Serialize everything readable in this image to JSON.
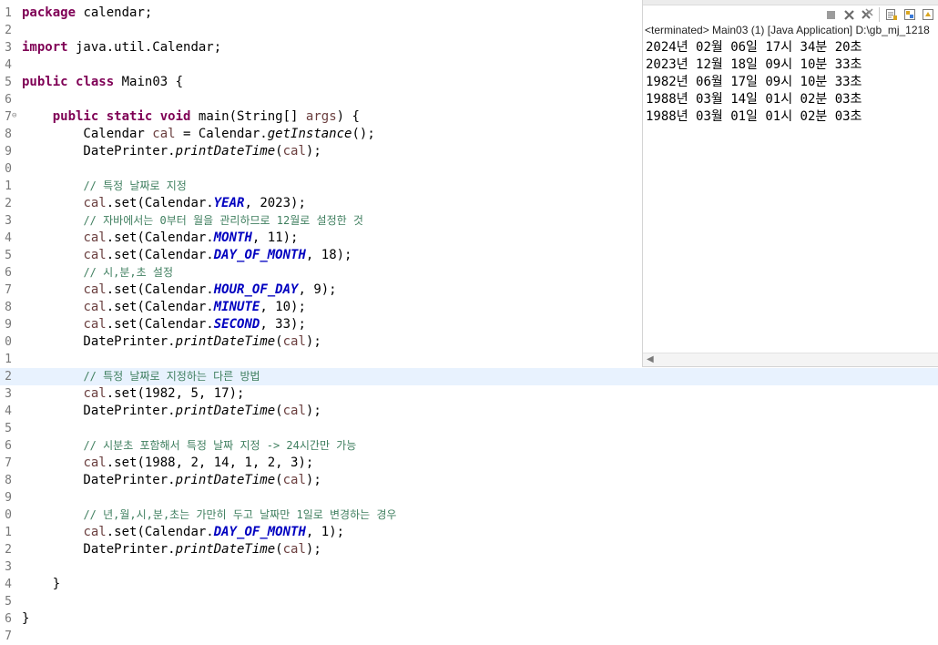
{
  "editor": {
    "lines": [
      {
        "num": "1",
        "tokens": [
          [
            "kw",
            "package"
          ],
          [
            "pl",
            " calendar;"
          ]
        ]
      },
      {
        "num": "2",
        "tokens": []
      },
      {
        "num": "3",
        "tokens": [
          [
            "kw",
            "import"
          ],
          [
            "pl",
            " java.util.Calendar;"
          ]
        ]
      },
      {
        "num": "4",
        "tokens": []
      },
      {
        "num": "5",
        "tokens": [
          [
            "kw",
            "public"
          ],
          [
            "pl",
            " "
          ],
          [
            "kw",
            "class"
          ],
          [
            "pl",
            " Main03 {"
          ]
        ]
      },
      {
        "num": "6",
        "tokens": []
      },
      {
        "num": "7",
        "fold": "⊖",
        "tokens": [
          [
            "pl",
            "    "
          ],
          [
            "kw",
            "public"
          ],
          [
            "pl",
            " "
          ],
          [
            "kw",
            "static"
          ],
          [
            "pl",
            " "
          ],
          [
            "kw",
            "void"
          ],
          [
            "pl",
            " main(String[] "
          ],
          [
            "var",
            "args"
          ],
          [
            "pl",
            ") {"
          ]
        ]
      },
      {
        "num": "8",
        "tokens": [
          [
            "pl",
            "        Calendar "
          ],
          [
            "var",
            "cal"
          ],
          [
            "pl",
            " = Calendar."
          ],
          [
            "mth",
            "getInstance"
          ],
          [
            "pl",
            "();"
          ]
        ]
      },
      {
        "num": "9",
        "tokens": [
          [
            "pl",
            "        DatePrinter."
          ],
          [
            "mth",
            "printDateTime"
          ],
          [
            "pl",
            "("
          ],
          [
            "var",
            "cal"
          ],
          [
            "pl",
            ");"
          ]
        ]
      },
      {
        "num": "0",
        "tokens": []
      },
      {
        "num": "1",
        "tokens": [
          [
            "pl",
            "        "
          ],
          [
            "cmt",
            "// 특정 날짜로 지정"
          ]
        ]
      },
      {
        "num": "2",
        "tokens": [
          [
            "pl",
            "        "
          ],
          [
            "var",
            "cal"
          ],
          [
            "pl",
            ".set(Calendar."
          ],
          [
            "cst",
            "YEAR"
          ],
          [
            "pl",
            ", 2023);"
          ]
        ]
      },
      {
        "num": "3",
        "tokens": [
          [
            "pl",
            "        "
          ],
          [
            "cmt",
            "// 자바에서는 0부터 월을 관리하므로 12월로 설정한 것"
          ]
        ]
      },
      {
        "num": "4",
        "tokens": [
          [
            "pl",
            "        "
          ],
          [
            "var",
            "cal"
          ],
          [
            "pl",
            ".set(Calendar."
          ],
          [
            "cst",
            "MONTH"
          ],
          [
            "pl",
            ", 11);"
          ]
        ]
      },
      {
        "num": "5",
        "tokens": [
          [
            "pl",
            "        "
          ],
          [
            "var",
            "cal"
          ],
          [
            "pl",
            ".set(Calendar."
          ],
          [
            "cst",
            "DAY_OF_MONTH"
          ],
          [
            "pl",
            ", 18);"
          ]
        ]
      },
      {
        "num": "6",
        "tokens": [
          [
            "pl",
            "        "
          ],
          [
            "cmt",
            "// 시,분,초 설정"
          ]
        ]
      },
      {
        "num": "7",
        "tokens": [
          [
            "pl",
            "        "
          ],
          [
            "var",
            "cal"
          ],
          [
            "pl",
            ".set(Calendar."
          ],
          [
            "cst",
            "HOUR_OF_DAY"
          ],
          [
            "pl",
            ", 9);"
          ]
        ]
      },
      {
        "num": "8",
        "tokens": [
          [
            "pl",
            "        "
          ],
          [
            "var",
            "cal"
          ],
          [
            "pl",
            ".set(Calendar."
          ],
          [
            "cst",
            "MINUTE"
          ],
          [
            "pl",
            ", 10);"
          ]
        ]
      },
      {
        "num": "9",
        "tokens": [
          [
            "pl",
            "        "
          ],
          [
            "var",
            "cal"
          ],
          [
            "pl",
            ".set(Calendar."
          ],
          [
            "cst",
            "SECOND"
          ],
          [
            "pl",
            ", 33);"
          ]
        ]
      },
      {
        "num": "0",
        "tokens": [
          [
            "pl",
            "        DatePrinter."
          ],
          [
            "mth",
            "printDateTime"
          ],
          [
            "pl",
            "("
          ],
          [
            "var",
            "cal"
          ],
          [
            "pl",
            ");"
          ]
        ]
      },
      {
        "num": "1",
        "tokens": []
      },
      {
        "num": "2",
        "highlight": true,
        "tokens": [
          [
            "pl",
            "        "
          ],
          [
            "cmt",
            "// 특정 날짜로 지정하는 다른 방법"
          ]
        ]
      },
      {
        "num": "3",
        "tokens": [
          [
            "pl",
            "        "
          ],
          [
            "var",
            "cal"
          ],
          [
            "pl",
            ".set(1982, 5, 17);"
          ]
        ]
      },
      {
        "num": "4",
        "tokens": [
          [
            "pl",
            "        DatePrinter."
          ],
          [
            "mth",
            "printDateTime"
          ],
          [
            "pl",
            "("
          ],
          [
            "var",
            "cal"
          ],
          [
            "pl",
            ");"
          ]
        ]
      },
      {
        "num": "5",
        "tokens": []
      },
      {
        "num": "6",
        "tokens": [
          [
            "pl",
            "        "
          ],
          [
            "cmt",
            "// 시분초 포함해서 특정 날짜 지정 -> 24시간만 가능"
          ]
        ]
      },
      {
        "num": "7",
        "tokens": [
          [
            "pl",
            "        "
          ],
          [
            "var",
            "cal"
          ],
          [
            "pl",
            ".set(1988, 2, 14, 1, 2, 3);"
          ]
        ]
      },
      {
        "num": "8",
        "tokens": [
          [
            "pl",
            "        DatePrinter."
          ],
          [
            "mth",
            "printDateTime"
          ],
          [
            "pl",
            "("
          ],
          [
            "var",
            "cal"
          ],
          [
            "pl",
            ");"
          ]
        ]
      },
      {
        "num": "9",
        "tokens": []
      },
      {
        "num": "0",
        "tokens": [
          [
            "pl",
            "        "
          ],
          [
            "cmt",
            "// 년,월,시,분,초는 가만히 두고 날짜만 1일로 변경하는 경우"
          ]
        ]
      },
      {
        "num": "1",
        "tokens": [
          [
            "pl",
            "        "
          ],
          [
            "var",
            "cal"
          ],
          [
            "pl",
            ".set(Calendar."
          ],
          [
            "cst",
            "DAY_OF_MONTH"
          ],
          [
            "pl",
            ", 1);"
          ]
        ]
      },
      {
        "num": "2",
        "tokens": [
          [
            "pl",
            "        DatePrinter."
          ],
          [
            "mth",
            "printDateTime"
          ],
          [
            "pl",
            "("
          ],
          [
            "var",
            "cal"
          ],
          [
            "pl",
            ");"
          ]
        ]
      },
      {
        "num": "3",
        "tokens": []
      },
      {
        "num": "4",
        "tokens": [
          [
            "pl",
            "    }"
          ]
        ]
      },
      {
        "num": "5",
        "tokens": []
      },
      {
        "num": "6",
        "tokens": [
          [
            "pl",
            "}"
          ]
        ]
      },
      {
        "num": "7",
        "tokens": []
      }
    ]
  },
  "console": {
    "terminated_label": "<terminated> Main03 (1) [Java Application] D:\\gb_mj_1218",
    "toolbar_icons": [
      "terminate-icon",
      "remove-launch-icon",
      "remove-all-terminated-icon",
      "scroll-lock-icon",
      "show-console-icon",
      "pin-console-icon"
    ],
    "output": [
      "2024년 02월 06일 17시 34분 20초",
      "2023년 12월 18일 09시 10분 33초",
      "1982년 06월 17일 09시 10분 33초",
      "1988년 03월 14일 01시 02분 03초",
      "1988년 03월 01일 01시 02분 03초"
    ],
    "scroll_arrow": "◀"
  }
}
